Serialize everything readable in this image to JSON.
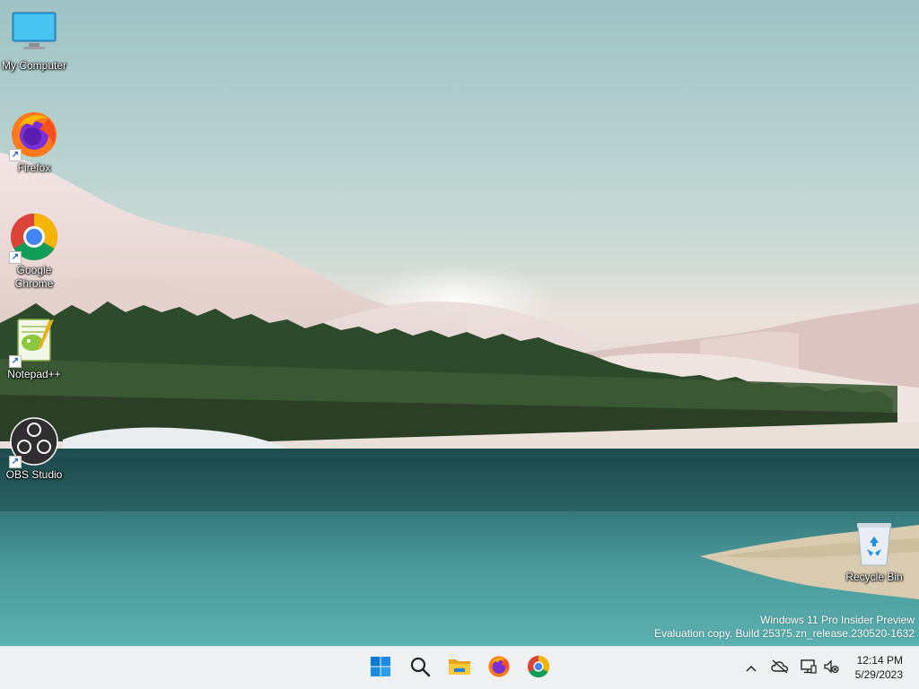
{
  "desktop": {
    "icons": [
      {
        "label": "My Computer",
        "icon": "monitor-icon",
        "shortcut": false
      },
      {
        "label": "Firefox",
        "icon": "firefox-icon",
        "shortcut": true
      },
      {
        "label": "Google Chrome",
        "icon": "chrome-icon",
        "shortcut": true
      },
      {
        "label": "Notepad++",
        "icon": "notepadpp-icon",
        "shortcut": true
      },
      {
        "label": "OBS Studio",
        "icon": "obs-icon",
        "shortcut": true
      },
      {
        "label": "Recycle Bin",
        "icon": "recycle-bin-icon",
        "shortcut": false
      }
    ],
    "watermark": {
      "line1": "Windows 11 Pro Insider Preview",
      "line2": "Evaluation copy. Build 25375.zn_release.230520-1632"
    }
  },
  "taskbar": {
    "pinned": [
      "start-icon",
      "search-icon",
      "file-explorer-icon",
      "firefox-icon",
      "chrome-icon"
    ],
    "tray": [
      "chevron-up-icon",
      "onedrive-offline-icon",
      "network-icon",
      "volume-muted-icon"
    ],
    "clock": {
      "time": "12:14 PM",
      "date": "5/29/2023"
    }
  },
  "colors": {
    "taskbar": "#eef0f2",
    "accent": "#0078d4"
  }
}
